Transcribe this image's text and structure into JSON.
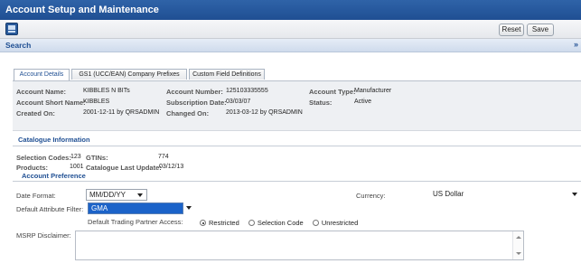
{
  "window": {
    "title": "Account Setup and Maintenance"
  },
  "toolbar": {
    "reset_label": "Reset",
    "save_label": "Save",
    "view_icon": "grid-view-icon"
  },
  "search": {
    "label": "Search",
    "toggle_icon": "»"
  },
  "tabs": [
    {
      "label": "Account Details",
      "active": true
    },
    {
      "label": "GS1 (UCC/EAN) Company Prefixes",
      "active": false
    },
    {
      "label": "Custom Field Definitions",
      "active": false
    }
  ],
  "account": {
    "name_label": "Account Name:",
    "name": "KIBBLES N BITs",
    "short_name_label": "Account Short Name:",
    "short_name": "KIBBLES",
    "created_label": "Created On:",
    "created": "2001-12-11 by QRSADMIN",
    "number_label": "Account Number:",
    "number": "125103335555",
    "subscription_label": "Subscription Date:",
    "subscription": "03/03/07",
    "changed_label": "Changed On:",
    "changed": "2013-03-12 by QRSADMIN",
    "type_label": "Account Type:",
    "type": "Manufacturer",
    "status_label": "Status:",
    "status": "Active"
  },
  "catalogue": {
    "title": "Catalogue Information",
    "selection_codes_label": "Selection Codes:",
    "selection_codes": "123",
    "gtins_label": "GTINs:",
    "gtins": "774",
    "products_label": "Products:",
    "products": "1001",
    "last_update_label": "Catalogue Last Update:",
    "last_update": "03/12/13"
  },
  "preference": {
    "title": "Account Preference",
    "date_format_label": "Date Format:",
    "date_format": "MM/DD/YY",
    "currency_label": "Currency:",
    "currency": "US Dollar",
    "attr_filter_label": "Default Attribute Filter:",
    "attr_filter": "GMA",
    "partner_access_label": "Default Trading Partner Access:",
    "partner_access_options": [
      "Restricted",
      "Selection Code",
      "Unrestricted"
    ],
    "partner_access_selected": "Restricted",
    "msrp_label": "MSRP Disclaimer:",
    "msrp_value": ""
  }
}
